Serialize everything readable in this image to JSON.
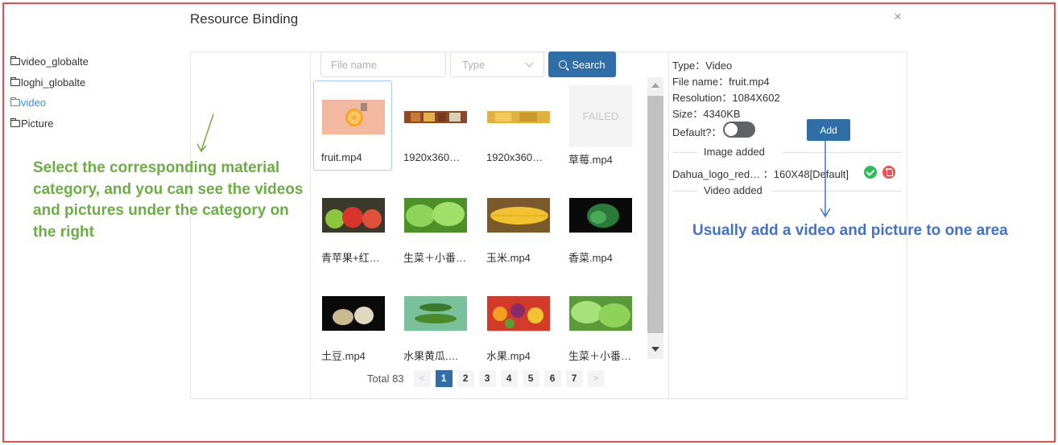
{
  "dialog": {
    "title": "Resource Binding",
    "close_icon": "×"
  },
  "tree": {
    "items": [
      {
        "label": "video_globalte",
        "active": false
      },
      {
        "label": "loghi_globalte",
        "active": false
      },
      {
        "label": "video",
        "active": true
      },
      {
        "label": "Picture",
        "active": false
      }
    ]
  },
  "search": {
    "file_placeholder": "File name",
    "type_placeholder": "Type",
    "button_label": "Search"
  },
  "files": [
    {
      "label": "fruit.mp4",
      "thumb": "orange"
    },
    {
      "label": "1920x360…",
      "thumb": "strip-food"
    },
    {
      "label": "1920x360…",
      "thumb": "strip-yellow"
    },
    {
      "label": "草莓.mp4",
      "thumb": "failed"
    },
    {
      "label": "青苹果+红…",
      "thumb": "apples"
    },
    {
      "label": "生菜＋小番…",
      "thumb": "lettuce"
    },
    {
      "label": "玉米.mp4",
      "thumb": "corn"
    },
    {
      "label": "香菜.mp4",
      "thumb": "coriander"
    },
    {
      "label": "土豆.mp4",
      "thumb": "potato"
    },
    {
      "label": "水果黄瓜.…",
      "thumb": "cucumber"
    },
    {
      "label": "水果.mp4",
      "thumb": "fruits"
    },
    {
      "label": "生菜＋小番…",
      "thumb": "lettuce2"
    }
  ],
  "failed_text": "FAILED",
  "pagination": {
    "total": "Total 83",
    "prev": "<",
    "next": ">",
    "pages": [
      "1",
      "2",
      "3",
      "4",
      "5",
      "6",
      "7"
    ],
    "current": "1"
  },
  "details": {
    "type": "Type：Video",
    "file_name": "File name：fruit.mp4",
    "resolution": "Resolution：1084X602",
    "size": "Size：4340KB",
    "default_label": "Default?：",
    "add_label": "Add",
    "image_added": "Image added",
    "image_entry": "Dahua_logo_red…  ：160X48[Default]",
    "video_added": "Video added"
  },
  "annotations": {
    "left": "Select the corresponding material category, and you can see the videos and pictures under the category on the right",
    "right": "Usually add a video and picture to one area"
  },
  "colors": {
    "accent": "#2f6ea6",
    "annot_green": "#6cae45",
    "annot_blue": "#4472c4",
    "frame_red": "#e05252"
  }
}
